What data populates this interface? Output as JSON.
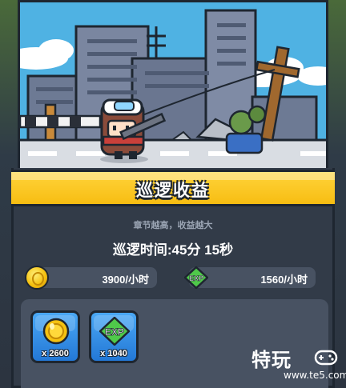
{
  "panel": {
    "title": "巡逻收益",
    "subtitle": "章节越高，收益越大",
    "patrol_time": "巡逻时间:45分 15秒"
  },
  "rates": {
    "gold": "3900/小时",
    "exp_label": "EXP",
    "exp": "1560/小时"
  },
  "rewards": [
    {
      "icon": "gold-coin-icon",
      "count": "x 2600"
    },
    {
      "icon": "exp-icon",
      "label": "EXP",
      "count": "x 1040"
    }
  ],
  "watermark": {
    "brand": "特玩",
    "url": "www.te5.com"
  },
  "colors": {
    "title_bar": "#ffd43b",
    "panel_bg": "#323b48",
    "pill_bg": "#485262",
    "card_blue": "#2f8ee8",
    "exp_green": "#4fc94a",
    "gold": "#f5c211"
  }
}
